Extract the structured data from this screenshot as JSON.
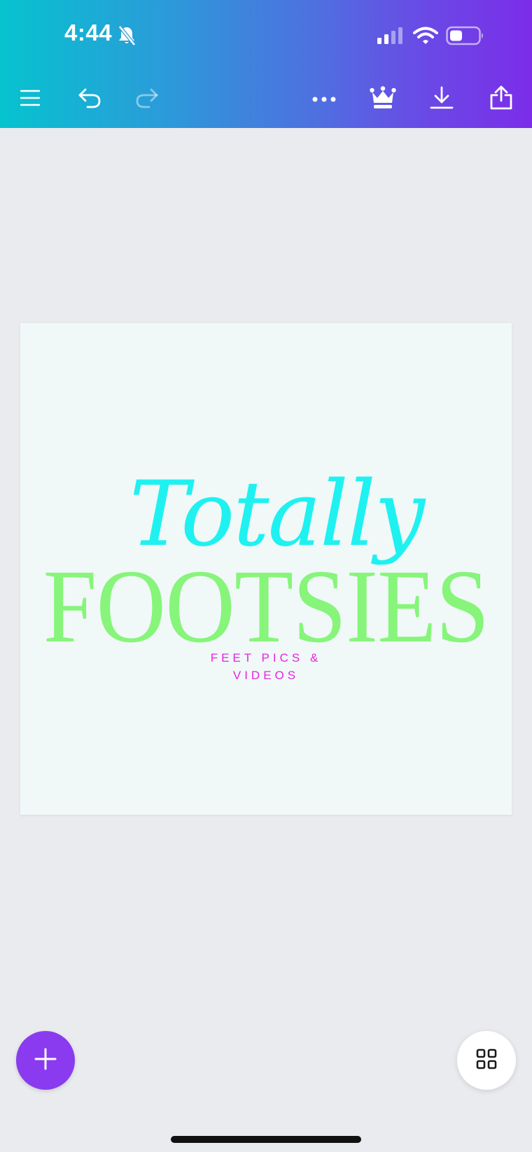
{
  "status_bar": {
    "time": "4:44",
    "icons": [
      "bell-slash-icon",
      "cellular-signal-icon",
      "wifi-icon",
      "battery-icon"
    ]
  },
  "toolbar": {
    "buttons": [
      "menu-icon",
      "undo-icon",
      "redo-icon",
      "more-icon",
      "crown-icon",
      "download-icon",
      "share-icon"
    ]
  },
  "design": {
    "script_text": "Totally",
    "title_text": "FOOTSIES",
    "subtitle_line1": "FEET PICS &",
    "subtitle_line2": "VIDEOS",
    "colors": {
      "script": "#1ff1f1",
      "title": "#86f57a",
      "subtitle": "#e823de",
      "page_background": "#f1f8f8"
    }
  },
  "bottom_actions": {
    "add": "plus-icon",
    "pages": "grid-icon"
  },
  "theme": {
    "gradient_start": "#06c3cf",
    "gradient_end": "#7b2de8",
    "fab_color": "#8a3bf0",
    "workspace_background": "#eaebef"
  }
}
